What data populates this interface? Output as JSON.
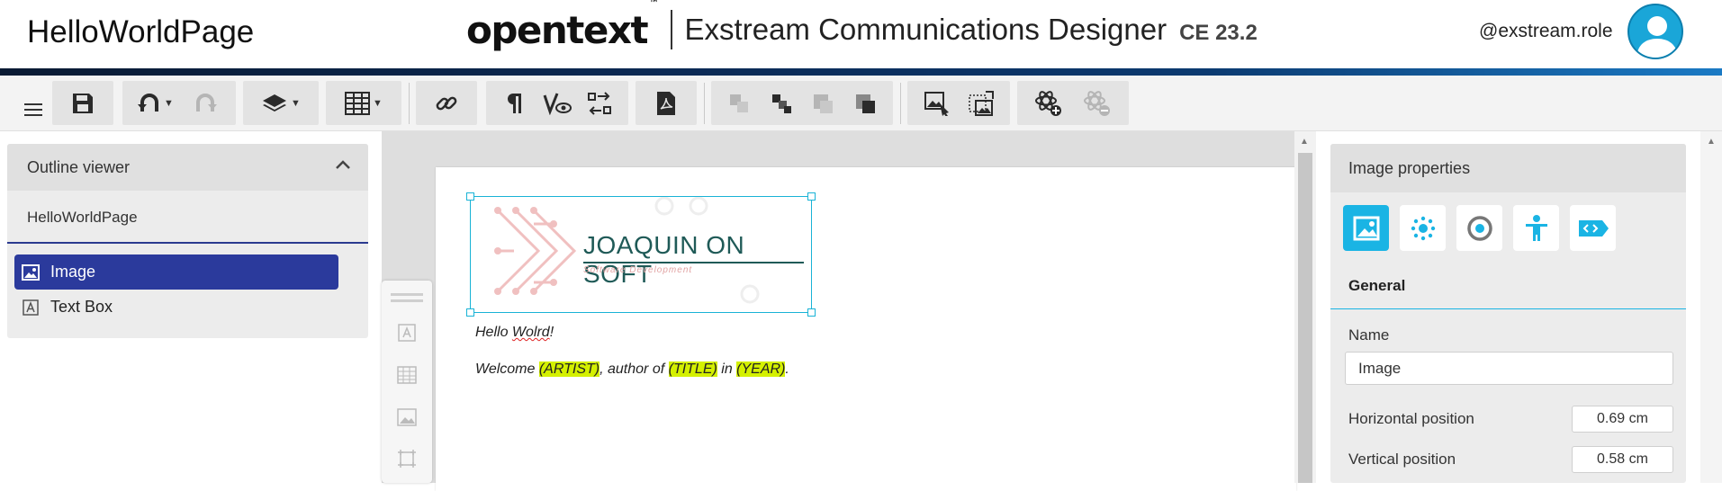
{
  "header": {
    "page_name": "HelloWorldPage",
    "brand_logo": "opentext",
    "brand_tm": "™",
    "product": "Exstream Communications Designer",
    "version": "CE 23.2",
    "user": "@exstream.role",
    "gradient_colors": [
      "#0a1a33",
      "#0b3a70",
      "#1b7ac4"
    ]
  },
  "toolbar": {
    "icons": [
      "menu-icon",
      "save-icon",
      "undo-icon",
      "redo-icon",
      "layers-icon",
      "table-icon",
      "link-icon",
      "paragraph-marks-icon",
      "validate-view-icon",
      "swap-icon",
      "pdf-icon",
      "bring-forward-icon",
      "send-backward-icon",
      "bring-to-front-icon",
      "send-to-back-icon",
      "replace-image-icon",
      "resize-image-icon",
      "add-content-icon",
      "remove-content-icon"
    ]
  },
  "outline": {
    "title": "Outline viewer",
    "document": "HelloWorldPage",
    "items": [
      {
        "label": "Image",
        "icon": "image-icon",
        "selected": true
      },
      {
        "label": "Text Box",
        "icon": "text-box-icon",
        "selected": false
      }
    ],
    "accent": "#2b3a9c"
  },
  "canvas": {
    "logo_text": "JOAQUIN ON SOFT",
    "logo_subtitle": "Software Development",
    "line1_before": "Hello ",
    "line1_misspelled": "Wolrd",
    "line1_after": "!",
    "line2": {
      "t1": "Welcome ",
      "v1": "(ARTIST)",
      "t2": ", author of ",
      "v2": "(TITLE)",
      "t3": " in ",
      "v3": "(YEAR)",
      "t4": "."
    },
    "highlight_color": "#d4f000",
    "selection_color": "#19b3d6"
  },
  "properties": {
    "title": "Image properties",
    "tabs": [
      "image-properties-icon",
      "effects-icon",
      "target-icon",
      "accessibility-icon",
      "tag-code-icon"
    ],
    "section": "General",
    "name_label": "Name",
    "name_value": "Image",
    "hpos_label": "Horizontal position",
    "hpos_value": "0.69 cm",
    "vpos_label": "Vertical position",
    "vpos_value": "0.58 cm",
    "accent": "#1ab4e4"
  }
}
